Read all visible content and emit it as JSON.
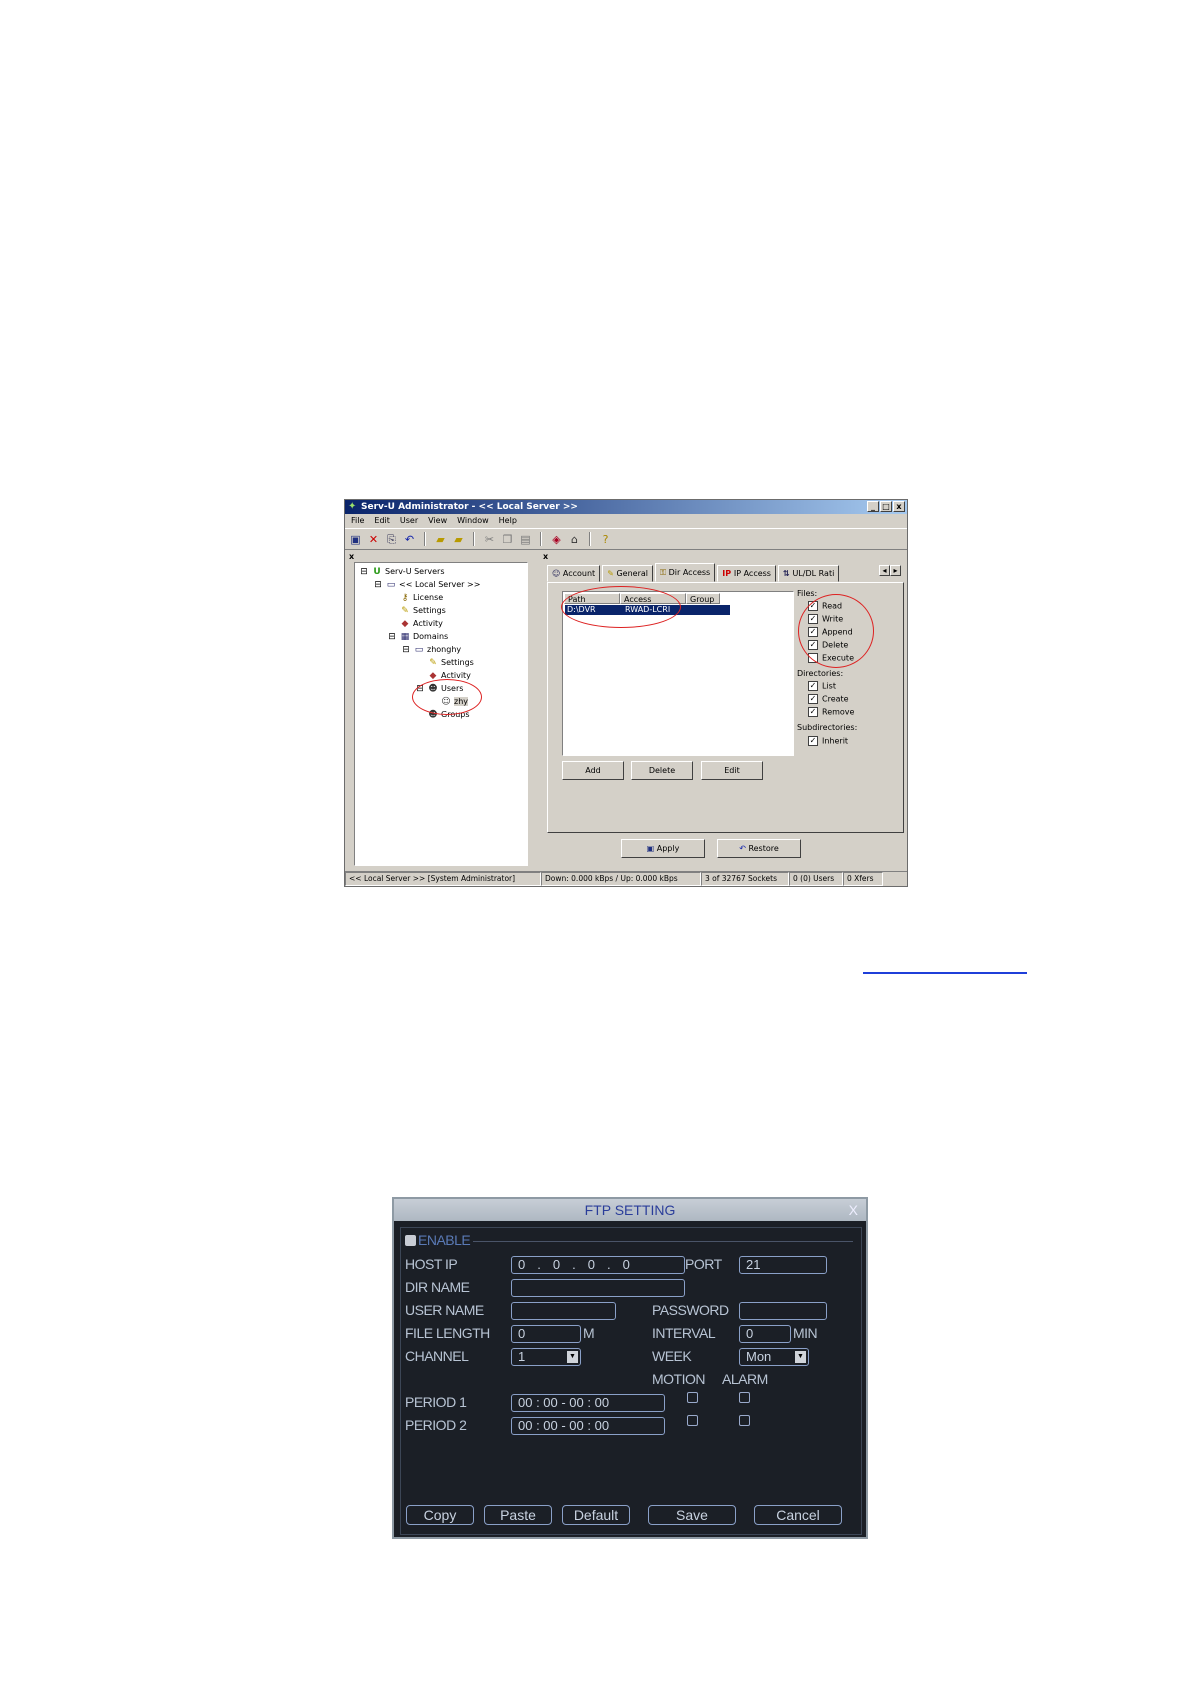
{
  "servu": {
    "title": "Serv-U Administrator - << Local Server >>",
    "window_buttons": [
      "_",
      "□",
      "x"
    ],
    "menu": [
      "File",
      "Edit",
      "User",
      "View",
      "Window",
      "Help"
    ],
    "pane_close": "x",
    "tree": {
      "root": "Serv-U Servers",
      "server": "<< Local Server >>",
      "license": "License",
      "settings": "Settings",
      "activity": "Activity",
      "domains": "Domains",
      "domain": "zhonghy",
      "domain_settings": "Settings",
      "domain_activity": "Activity",
      "users": "Users",
      "user": "zhy",
      "groups": "Groups"
    },
    "tabs": [
      "Account",
      "General",
      "Dir Access",
      "IP Access",
      "UL/DL Rati"
    ],
    "table": {
      "headers": [
        "Path",
        "Access",
        "Group"
      ],
      "rows": [
        {
          "path": "D:\\DVR",
          "access": "RWAD-LCRI",
          "group": ""
        }
      ]
    },
    "files_label": "Files:",
    "files": [
      {
        "label": "Read",
        "checked": true
      },
      {
        "label": "Write",
        "checked": true
      },
      {
        "label": "Append",
        "checked": true
      },
      {
        "label": "Delete",
        "checked": true
      },
      {
        "label": "Execute",
        "checked": false
      }
    ],
    "directories_label": "Directories:",
    "directories": [
      {
        "label": "List",
        "checked": true
      },
      {
        "label": "Create",
        "checked": true
      },
      {
        "label": "Remove",
        "checked": true
      }
    ],
    "subdirectories_label": "Subdirectories:",
    "inherit_label": "Inherit",
    "buttons": {
      "add": "Add",
      "delete": "Delete",
      "edit": "Edit",
      "apply": "Apply",
      "restore": "Restore"
    },
    "status": [
      "<< Local Server >>  [System Administrator]",
      "Down: 0.000 kBps / Up: 0.000 kBps",
      "3 of 32767 Sockets",
      "0 (0) Users",
      "0 Xfers"
    ]
  },
  "ftp": {
    "title": "FTP SETTING",
    "close": "X",
    "enable": "ENABLE",
    "host_ip_label": "HOST IP",
    "host_ip": [
      "0",
      "0",
      "0",
      "0"
    ],
    "port_label": "PORT",
    "port": "21",
    "dir_name_label": "DIR NAME",
    "user_name_label": "USER NAME",
    "password_label": "PASSWORD",
    "file_length_label": "FILE LENGTH",
    "file_length": "0",
    "file_length_unit": "M",
    "interval_label": "INTERVAL",
    "interval": "0",
    "interval_unit": "MIN",
    "channel_label": "CHANNEL",
    "channel": "1",
    "week_label": "WEEK",
    "week": "Mon",
    "motion_label": "MOTION",
    "alarm_label": "ALARM",
    "period1_label": "PERIOD 1",
    "period1": "00 : 00     - 00 : 00",
    "period2_label": "PERIOD 2",
    "period2": "00 : 00     - 00 : 00",
    "buttons": {
      "copy": "Copy",
      "paste": "Paste",
      "default": "Default",
      "save": "Save",
      "cancel": "Cancel"
    }
  }
}
